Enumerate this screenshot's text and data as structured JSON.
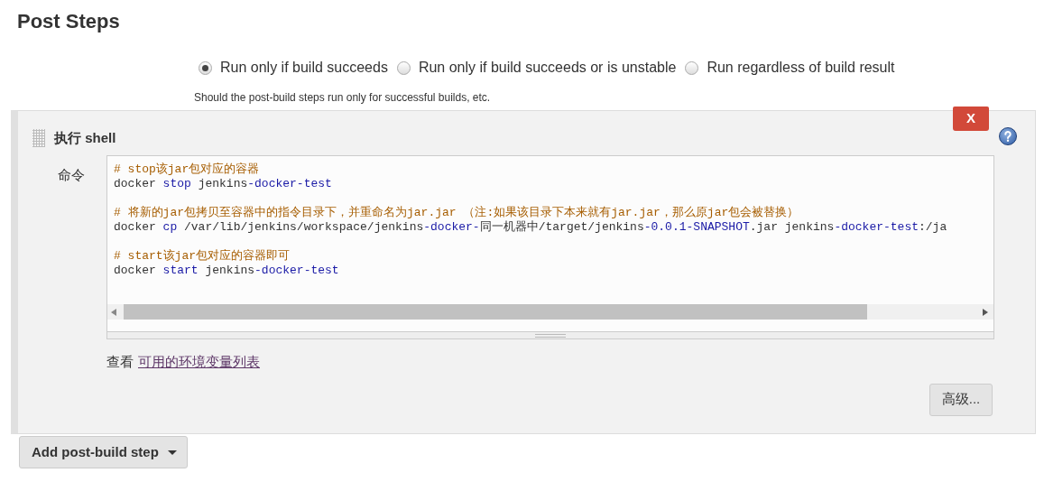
{
  "section_title": "Post Steps",
  "run_conditions": [
    {
      "label": "Run only if build succeeds",
      "selected": true
    },
    {
      "label": "Run only if build succeeds or is unstable",
      "selected": false
    },
    {
      "label": "Run regardless of build result",
      "selected": false
    }
  ],
  "run_conditions_help": "Should the post-build steps run only for successful builds, etc.",
  "step": {
    "title": "执行 shell",
    "delete_label": "X",
    "field_label": "命令",
    "code_lines": [
      [
        {
          "text": "# stop该jar包对应的容器",
          "kind": "comment"
        }
      ],
      [
        {
          "text": "docker ",
          "kind": "plain"
        },
        {
          "text": "stop",
          "kind": "keyword"
        },
        {
          "text": " jenkins",
          "kind": "plain"
        },
        {
          "text": "-docker-test",
          "kind": "keyword"
        }
      ],
      {
        "kind": "blank"
      },
      [
        {
          "text": "# 将新的jar包拷贝至容器中的指令目录下，并重命名为jar.jar （注:如果该目录下本来就有jar.jar，那么原jar包会被替换）",
          "kind": "comment"
        }
      ],
      [
        {
          "text": "docker ",
          "kind": "plain"
        },
        {
          "text": "cp",
          "kind": "keyword"
        },
        {
          "text": " /var/lib/jenkins/workspace/jenkins",
          "kind": "plain"
        },
        {
          "text": "-docker-",
          "kind": "keyword"
        },
        {
          "text": "同一机器中/target/jenkins",
          "kind": "plain"
        },
        {
          "text": "-0.0.1-SNAPSHOT",
          "kind": "keyword"
        },
        {
          "text": ".jar jenkins",
          "kind": "plain"
        },
        {
          "text": "-docker-test",
          "kind": "keyword"
        },
        {
          "text": ":/ja",
          "kind": "plain"
        }
      ],
      {
        "kind": "blank"
      },
      [
        {
          "text": "# start该jar包对应的容器即可",
          "kind": "comment"
        }
      ],
      [
        {
          "text": "docker ",
          "kind": "plain"
        },
        {
          "text": "start",
          "kind": "keyword"
        },
        {
          "text": " jenkins",
          "kind": "plain"
        },
        {
          "text": "-docker-test",
          "kind": "keyword"
        }
      ]
    ],
    "env_prefix": "查看",
    "env_link": "可用的环境变量列表",
    "advanced_button": "高级..."
  },
  "add_button": "Add post-build step"
}
